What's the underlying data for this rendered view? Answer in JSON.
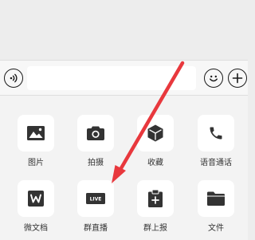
{
  "input_bar": {
    "voice_icon": "voice-wave-icon",
    "message_value": "",
    "emoji_icon": "smiley-icon",
    "more_icon": "plus-icon"
  },
  "panel": {
    "items": [
      {
        "label": "图片",
        "icon": "image-icon"
      },
      {
        "label": "拍摄",
        "icon": "camera-icon"
      },
      {
        "label": "收藏",
        "icon": "cube-icon"
      },
      {
        "label": "语音通话",
        "icon": "phone-icon"
      },
      {
        "label": "微文档",
        "icon": "document-w-icon"
      },
      {
        "label": "群直播",
        "icon": "live-icon",
        "badge": "LIVE"
      },
      {
        "label": "群上报",
        "icon": "clipboard-plus-icon"
      },
      {
        "label": "文件",
        "icon": "folder-icon"
      }
    ]
  },
  "annotation": {
    "arrow_color": "#e8383d",
    "points_to": "群直播"
  },
  "colors": {
    "panel_bg": "#f3f3f3",
    "tile_bg": "#ffffff",
    "icon_fill": "#333333"
  }
}
